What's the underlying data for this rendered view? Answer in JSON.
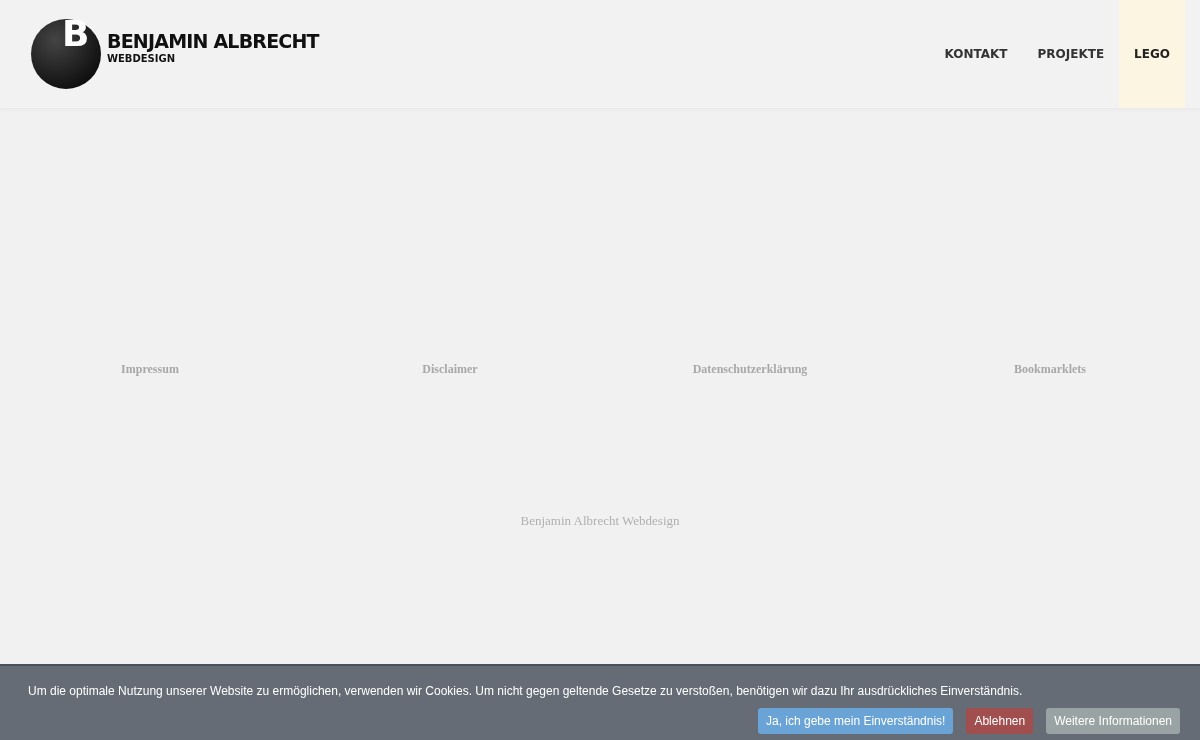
{
  "header": {
    "logo_letter": "B",
    "brand": "BENJAMIN ALBRECHT",
    "tagline": "WEBDESIGN"
  },
  "nav": [
    {
      "label": "KONTAKT",
      "selected": false
    },
    {
      "label": "PROJEKTE",
      "selected": false
    },
    {
      "label": "LEGO",
      "selected": true
    }
  ],
  "footer_links": [
    "Impressum",
    "Disclaimer",
    "Datenschutzerklärung",
    "Bookmarklets"
  ],
  "footer_contact": [
    "Benjamin Albrecht Webdesign"
  ],
  "cookie_bar": {
    "text": "Um die optimale Nutzung unserer Website zu ermöglichen, verwenden wir Cookies. Um nicht gegen geltende Gesetze zu verstoßen, benötigen wir dazu Ihr ausdrückliches Einverständnis.",
    "buttons": [
      {
        "label": "Ja, ich gebe mein Einverständnis!",
        "kind": "accept"
      },
      {
        "label": "Ablehnen",
        "kind": "decline"
      },
      {
        "label": "Weitere Informationen",
        "kind": "info"
      }
    ]
  }
}
